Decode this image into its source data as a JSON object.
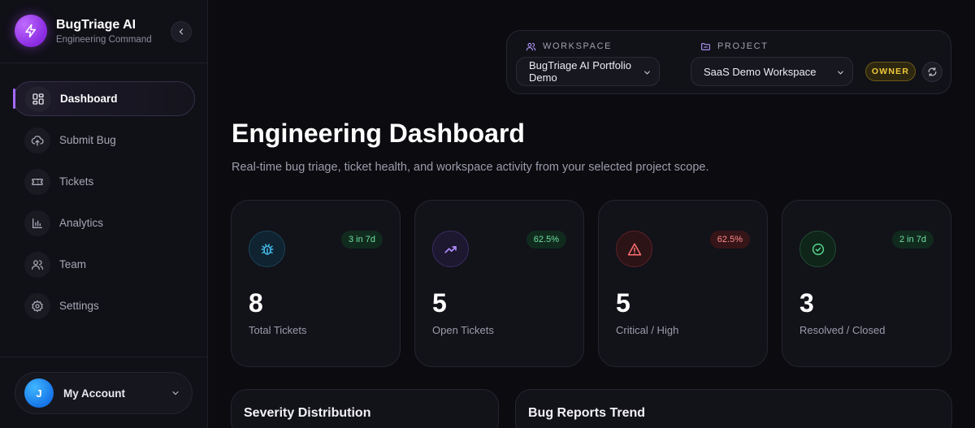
{
  "brand": {
    "name": "BugTriage AI",
    "subtitle": "Engineering Command"
  },
  "nav": [
    {
      "label": "Dashboard",
      "icon": "dashboard-grid-icon",
      "active": true
    },
    {
      "label": "Submit Bug",
      "icon": "upload-cloud-icon"
    },
    {
      "label": "Tickets",
      "icon": "ticket-icon"
    },
    {
      "label": "Analytics",
      "icon": "bar-chart-icon"
    },
    {
      "label": "Team",
      "icon": "users-icon"
    },
    {
      "label": "Settings",
      "icon": "gear-icon"
    }
  ],
  "account": {
    "initial": "J",
    "label": "My Account"
  },
  "scope": {
    "workspace_label": "WORKSPACE",
    "workspace_value": "BugTriage AI Portfolio Demo",
    "project_label": "PROJECT",
    "project_value": "SaaS Demo Workspace",
    "role_badge": "OWNER"
  },
  "header": {
    "title": "Engineering Dashboard",
    "subtitle": "Real-time bug triage, ticket health, and workspace activity from your selected project scope."
  },
  "stats": [
    {
      "value": "8",
      "label": "Total Tickets",
      "badge": "3 in 7d",
      "badge_tone": "green",
      "icon": "bug-icon",
      "accent": "#3aa8d8"
    },
    {
      "value": "5",
      "label": "Open Tickets",
      "badge": "62.5%",
      "badge_tone": "green",
      "icon": "trending-up-icon",
      "accent": "#a67cff"
    },
    {
      "value": "5",
      "label": "Critical / High",
      "badge": "62.5%",
      "badge_tone": "red",
      "icon": "alert-triangle-icon",
      "accent": "#ff6b6b"
    },
    {
      "value": "3",
      "label": "Resolved / Closed",
      "badge": "2 in 7d",
      "badge_tone": "green",
      "icon": "check-circle-icon",
      "accent": "#4fd08a"
    }
  ],
  "panels": [
    {
      "title": "Severity Distribution"
    },
    {
      "title": "Bug Reports Trend"
    }
  ],
  "colors": {
    "background": "#0b0b10",
    "accent_purple": "#a56cff",
    "owner_gold": "#f0c93a"
  }
}
